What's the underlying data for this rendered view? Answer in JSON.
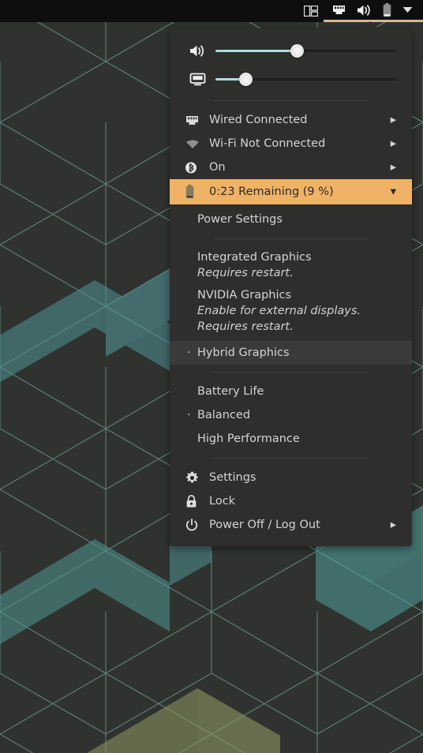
{
  "topbar": {
    "items": [
      {
        "name": "workspace-tiling-icon",
        "label": "Workspaces"
      },
      {
        "name": "wired-network-icon",
        "label": "Wired Network"
      },
      {
        "name": "volume-icon",
        "label": "Volume"
      },
      {
        "name": "battery-icon",
        "label": "Battery"
      },
      {
        "name": "chevron-down-icon",
        "label": "Open menu"
      }
    ],
    "accent_underline": "#d8b894",
    "background": "#0e0e0e"
  },
  "menu": {
    "volume_slider": {
      "icon": "volume-icon",
      "value": 45,
      "min": 0,
      "max": 100
    },
    "brightness_slider": {
      "icon": "display-brightness-icon",
      "value": 17,
      "min": 0,
      "max": 100
    },
    "network": [
      {
        "icon": "wired-network-icon",
        "label": "Wired Connected",
        "chevron": "▸"
      },
      {
        "icon": "wifi-icon",
        "label": "Wi-Fi Not Connected",
        "chevron": "▸"
      },
      {
        "icon": "bluetooth-icon",
        "label": "On",
        "chevron": "▸"
      }
    ],
    "battery": {
      "icon": "battery-low-icon",
      "label": "0:23 Remaining (9 %)",
      "chevron": "▾",
      "highlight_color": "#f0b266",
      "text_color": "#2a2a28"
    },
    "power_settings": {
      "label": "Power Settings"
    },
    "graphics": [
      {
        "title": "Integrated Graphics",
        "subtitles": [
          "Requires restart."
        ],
        "selected": false
      },
      {
        "title": "NVIDIA Graphics",
        "subtitles": [
          "Enable for external displays.",
          "Requires restart."
        ],
        "selected": false
      },
      {
        "title": "Hybrid Graphics",
        "subtitles": [],
        "selected": true,
        "hovered": true
      }
    ],
    "profiles": [
      {
        "label": "Battery Life",
        "selected": false
      },
      {
        "label": "Balanced",
        "selected": true
      },
      {
        "label": "High Performance",
        "selected": false
      }
    ],
    "selected_marker": "·",
    "system": [
      {
        "icon": "gear-icon",
        "label": "Settings",
        "chevron": ""
      },
      {
        "icon": "lock-icon",
        "label": "Lock",
        "chevron": ""
      },
      {
        "icon": "power-icon",
        "label": "Power Off / Log Out",
        "chevron": "▸"
      }
    ]
  },
  "colors": {
    "panel_bg": "#2e2e2c",
    "slider_fill": "#a8dede",
    "text": "#d4d4d4",
    "wallpaper_bg": "#2f322f",
    "wallpaper_line": "#5f8f8a",
    "wallpaper_teal": "#56a0a0",
    "wallpaper_olive": "#8f9a63"
  }
}
